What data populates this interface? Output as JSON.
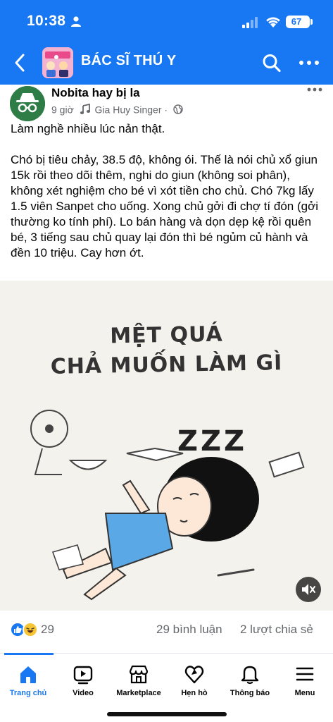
{
  "status_bar": {
    "time": "10:38",
    "battery": "67"
  },
  "nav": {
    "title": "BÁC SĨ THÚ Y"
  },
  "post": {
    "author": "Nobita hay bị la",
    "time": "9 giờ",
    "separator": "·",
    "music": "Gia Huy Singer",
    "paragraph_1": "Làm nghề nhiều lúc nản thật.",
    "paragraph_2": "Chó bị tiêu chảy, 38.5 độ, không ói. Thế là nói chủ xổ giun 15k rồi theo dõi thêm, nghi do giun (không soi phân), không xét nghiệm cho bé vì xót tiền cho chủ. Chó 7kg lấy 1.5 viên Sanpet cho uống. Xong chủ gởi đi chợ tí đón (gởi thường ko tính phí). Lo bán hàng và dọn dẹp kệ rồi quên bé, 3 tiếng sau chủ quay lại đón thì bé ngủm củ hành và đền 10 triệu. Cay hơn ớt.",
    "image": {
      "caption_line_1": "MỆT QUÁ",
      "caption_line_2": "CHẢ MUỐN LÀM GÌ",
      "sleep_text": "ZZZ"
    },
    "reactions": {
      "count": "29",
      "comments": "29 bình luận",
      "shares": "2 lượt chia sẻ"
    }
  },
  "bottom_nav": [
    {
      "label": "Trang chủ",
      "icon": "home-icon",
      "active": true
    },
    {
      "label": "Video",
      "icon": "video-icon",
      "active": false
    },
    {
      "label": "Marketplace",
      "icon": "marketplace-icon",
      "active": false
    },
    {
      "label": "Hẹn hò",
      "icon": "dating-heart-icon",
      "active": false
    },
    {
      "label": "Thông báo",
      "icon": "bell-icon",
      "active": false
    },
    {
      "label": "Menu",
      "icon": "hamburger-menu-icon",
      "active": false
    }
  ],
  "colors": {
    "brand": "#1877f2",
    "muted_text": "#65676b",
    "text": "#050505",
    "background": "#ffffff"
  }
}
